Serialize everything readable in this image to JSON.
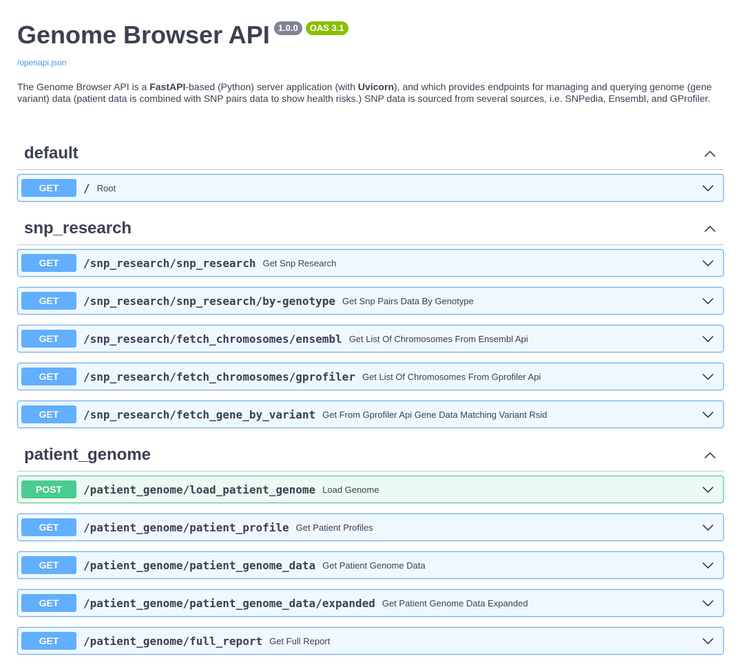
{
  "info": {
    "title": "Genome Browser API",
    "version": "1.0.0",
    "oas": "OAS 3.1",
    "spec_link": "/openapi.json",
    "description_parts": [
      "The Genome Browser API is a ",
      "FastAPI",
      "-based (Python) server application (with ",
      "Uvicorn",
      "), and which provides endpoints for managing and querying genome (gene variant) data (patient data is combined with SNP pairs data to show health risks.) SNP data is sourced from several sources, i.e. SNPedia, Ensembl, and GProfiler."
    ]
  },
  "colors": {
    "get": "#61affe",
    "post": "#49cc90",
    "link": "#4990e2",
    "badge_version": "#7d8492",
    "badge_oas": "#89bf04"
  },
  "icons": {
    "collapse": "chevron-up-icon",
    "expand": "chevron-down-icon"
  },
  "tags": [
    {
      "name": "default",
      "operations": [
        {
          "method": "GET",
          "path": "/",
          "summary": "Root"
        }
      ]
    },
    {
      "name": "snp_research",
      "operations": [
        {
          "method": "GET",
          "path": "/snp_research/snp_research",
          "summary": "Get Snp Research"
        },
        {
          "method": "GET",
          "path": "/snp_research/snp_research/by-genotype",
          "summary": "Get Snp Pairs Data By Genotype"
        },
        {
          "method": "GET",
          "path": "/snp_research/fetch_chromosomes/ensembl",
          "summary": "Get List Of Chromosomes From Ensembl Api"
        },
        {
          "method": "GET",
          "path": "/snp_research/fetch_chromosomes/gprofiler",
          "summary": "Get List Of Chromosomes From Gprofiler Api"
        },
        {
          "method": "GET",
          "path": "/snp_research/fetch_gene_by_variant",
          "summary": "Get From Gprofiler Api Gene Data Matching Variant Rsid"
        }
      ]
    },
    {
      "name": "patient_genome",
      "operations": [
        {
          "method": "POST",
          "path": "/patient_genome/load_patient_genome",
          "summary": "Load Genome"
        },
        {
          "method": "GET",
          "path": "/patient_genome/patient_profile",
          "summary": "Get Patient Profiles"
        },
        {
          "method": "GET",
          "path": "/patient_genome/patient_genome_data",
          "summary": "Get Patient Genome Data"
        },
        {
          "method": "GET",
          "path": "/patient_genome/patient_genome_data/expanded",
          "summary": "Get Patient Genome Data Expanded"
        },
        {
          "method": "GET",
          "path": "/patient_genome/full_report",
          "summary": "Get Full Report"
        }
      ]
    }
  ]
}
